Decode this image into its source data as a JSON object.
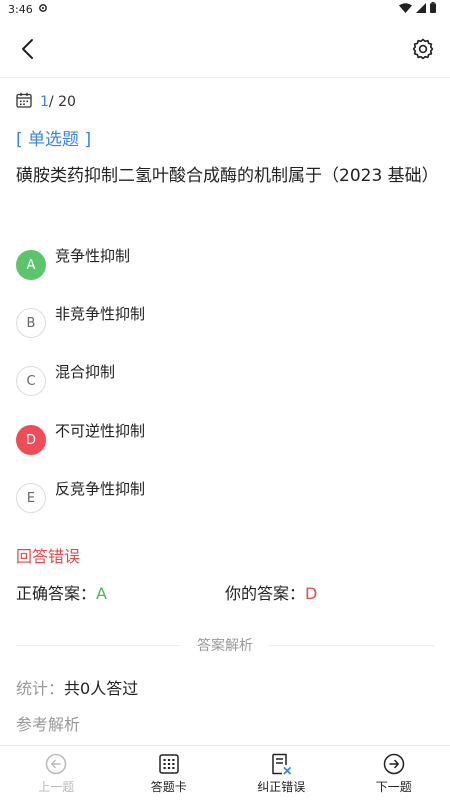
{
  "status_bar": {
    "time": "3:46"
  },
  "question": {
    "current": "1",
    "total": "/ 20",
    "type": "[ 单选题 ]",
    "text": "磺胺类药抑制二氢叶酸合成酶的机制属于（2023 基础）"
  },
  "options": [
    {
      "letter": "A",
      "text": "竞争性抑制",
      "state": "correct"
    },
    {
      "letter": "B",
      "text": "非竞争性抑制",
      "state": "normal"
    },
    {
      "letter": "C",
      "text": "混合抑制",
      "state": "normal"
    },
    {
      "letter": "D",
      "text": "不可逆性抑制",
      "state": "wrong"
    },
    {
      "letter": "E",
      "text": "反竞争性抑制",
      "state": "normal"
    }
  ],
  "result": {
    "status": "回答错误",
    "correct_label": "正确答案：",
    "correct_value": "A",
    "mine_label": "你的答案：",
    "mine_value": "D"
  },
  "analysis": {
    "section_title": "答案解析",
    "stats_label": "统计：",
    "stats_value": "共0人答过",
    "reference_label": "参考解析"
  },
  "bottom_nav": {
    "prev": "上一题",
    "card": "答题卡",
    "report": "纠正错误",
    "next": "下一题"
  },
  "colors": {
    "accent": "#3a86d8",
    "correct": "#5cc46a",
    "wrong": "#ef4c5a"
  }
}
